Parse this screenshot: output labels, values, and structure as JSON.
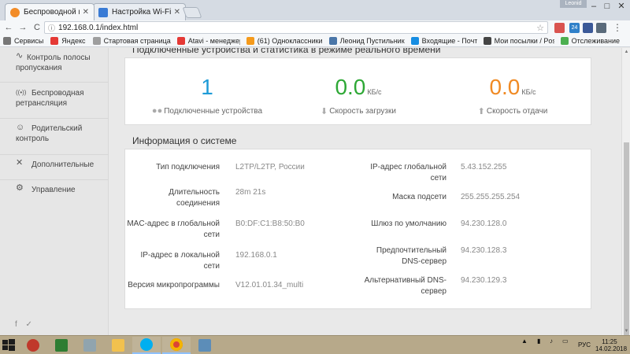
{
  "browser": {
    "tabs": [
      {
        "title": "Беспроводной маршрути",
        "active": true,
        "favicon_color": "#f28c28"
      },
      {
        "title": "Настройка Wi-Fi роутер",
        "active": false,
        "favicon_color": "#3a7bd5"
      }
    ],
    "profile_label": "Leonid",
    "window_controls": {
      "minimize": "–",
      "maximize": "□",
      "close": "✕"
    },
    "nav": {
      "back": "←",
      "forward": "→",
      "reload": "C"
    },
    "url": "192.168.0.1/index.html",
    "menu_icon": "⋮",
    "extensions_badge": "24"
  },
  "bookmarks": [
    {
      "label": "Сервисы",
      "icon": "apps-icon",
      "color": "#777777"
    },
    {
      "label": "Яндекс",
      "icon": "yandex-icon",
      "color": "#e53935"
    },
    {
      "label": "Стартовая страница",
      "icon": "page-icon",
      "color": "#9e9e9e"
    },
    {
      "label": "Atavi - менеджер за",
      "icon": "atavi-icon",
      "color": "#e53935"
    },
    {
      "label": "(61) Одноклассники",
      "icon": "ok-icon",
      "color": "#f59a1b"
    },
    {
      "label": "Леонид Пустильник",
      "icon": "vk-icon",
      "color": "#4a76a8"
    },
    {
      "label": "Входящие - Почта М",
      "icon": "mail-icon",
      "color": "#168de2"
    },
    {
      "label": "Мои посылки / Posts",
      "icon": "package-icon",
      "color": "#444444"
    },
    {
      "label": "Отслеживание",
      "icon": "tracking-icon",
      "color": "#4caf50"
    }
  ],
  "sidebar": {
    "items": [
      {
        "label": "Контроль полосы пропускания",
        "icon": "bandwidth-icon",
        "glyph": "∿"
      },
      {
        "label": "Беспроводная ретрансляция",
        "icon": "wireless-repeater-icon",
        "glyph": "((•))"
      },
      {
        "label": "Родительский контроль",
        "icon": "parental-control-icon",
        "glyph": "☺"
      },
      {
        "label": "Дополнительные",
        "icon": "tools-icon",
        "glyph": "✕"
      },
      {
        "label": "Управление",
        "icon": "gear-icon",
        "glyph": "⚙"
      }
    ],
    "social": "f ✓"
  },
  "realtime": {
    "title": "Подключенные устройства и статистика в режиме реального времени",
    "stats": [
      {
        "value": "1",
        "unit": "",
        "label": "Подключенные устройства",
        "color": "#1e9bd7",
        "icon": "users-icon",
        "glyph": "👥"
      },
      {
        "value": "0.0",
        "unit": "КБ/с",
        "label": "Скорость загрузки",
        "color": "#2ea836",
        "icon": "download-icon",
        "glyph": "⬇"
      },
      {
        "value": "0.0",
        "unit": "КБ/с",
        "label": "Скорость отдачи",
        "color": "#f08a24",
        "icon": "upload-icon",
        "glyph": "⬆"
      }
    ]
  },
  "system": {
    "title": "Информация о системе",
    "left": [
      {
        "label": "Тип подключения",
        "value": "L2TP/L2TP, России"
      },
      {
        "label": "Длительность соединения",
        "value": "28m 21s"
      },
      {
        "label": "MAC-адрес в глобальной сети",
        "value": "B0:DF:C1:B8:50:B0"
      },
      {
        "label": "IP-адрес в локальной сети",
        "value": "192.168.0.1"
      },
      {
        "label": "Версия микропрограммы",
        "value": "V12.01.01.34_multi"
      }
    ],
    "right": [
      {
        "label": "IP-адрес глобальной сети",
        "value": "5.43.152.255"
      },
      {
        "label": "Маска подсети",
        "value": "255.255.255.254"
      },
      {
        "label": "Шлюз по умолчанию",
        "value": "94.230.128.0"
      },
      {
        "label": "Предпочтительный DNS-сервер",
        "value": "94.230.128.3"
      },
      {
        "label": "Альтернативный DNS-сервер",
        "value": "94.230.129.3"
      }
    ]
  },
  "taskbar": {
    "apps": [
      {
        "name": "search-app",
        "color": "#c0392b",
        "open": false
      },
      {
        "name": "calculator-app",
        "color": "#2e7d32",
        "open": false
      },
      {
        "name": "notes-app",
        "color": "#90a4ae",
        "open": false
      },
      {
        "name": "file-explorer-app",
        "color": "#f2c14e",
        "open": false
      },
      {
        "name": "skype-app",
        "color": "#00aff0",
        "open": true
      },
      {
        "name": "chrome-app",
        "color": "#db4437",
        "open": true
      },
      {
        "name": "remote-app",
        "color": "#5c8db8",
        "open": false
      }
    ],
    "language": "РУС",
    "time": "11:25",
    "date": "14.02.2018"
  }
}
